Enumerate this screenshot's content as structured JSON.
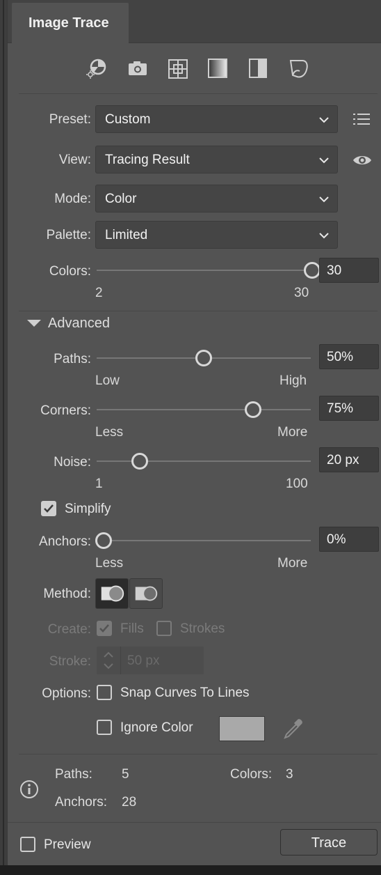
{
  "panel": {
    "tab_title": "Image Trace"
  },
  "preset_icons": [
    "auto-color-icon",
    "high-color-icon",
    "low-color-icon",
    "grayscale-icon",
    "black-and-white-icon",
    "outline-icon"
  ],
  "preset": {
    "label": "Preset:",
    "value": "Custom"
  },
  "view": {
    "label": "View:",
    "value": "Tracing Result"
  },
  "mode": {
    "label": "Mode:",
    "value": "Color"
  },
  "palette": {
    "label": "Palette:",
    "value": "Limited"
  },
  "colors": {
    "label": "Colors:",
    "value": "30",
    "min": "2",
    "max": "30",
    "level": 1.0
  },
  "advanced": {
    "label": "Advanced",
    "expanded": true
  },
  "paths": {
    "label": "Paths:",
    "value": "50%",
    "min": "Low",
    "max": "High",
    "level": 0.5
  },
  "corners": {
    "label": "Corners:",
    "value": "75%",
    "min": "Less",
    "max": "More",
    "level": 0.73
  },
  "noise": {
    "label": "Noise:",
    "value": "20 px",
    "min": "1",
    "max": "100",
    "level": 0.2
  },
  "simplify": {
    "label": "Simplify",
    "checked": true
  },
  "anchors": {
    "label": "Anchors:",
    "value": "0%",
    "min": "Less",
    "max": "More",
    "level": 0.0
  },
  "method": {
    "label": "Method:",
    "selected": "abutting"
  },
  "create": {
    "label": "Create:",
    "fills_label": "Fills",
    "fills_checked": true,
    "strokes_label": "Strokes",
    "strokes_checked": false
  },
  "stroke": {
    "label": "Stroke:",
    "value": "50 px"
  },
  "options": {
    "label": "Options:",
    "snap_label": "Snap Curves To Lines",
    "snap_checked": false,
    "ignore_label": "Ignore Color",
    "ignore_checked": false,
    "ignore_swatch": "#a9a9a9"
  },
  "info": {
    "paths_label": "Paths:",
    "paths_value": "5",
    "colors_label": "Colors:",
    "colors_value": "3",
    "anchors_label": "Anchors:",
    "anchors_value": "28"
  },
  "footer": {
    "preview_label": "Preview",
    "preview_checked": false,
    "trace_label": "Trace"
  }
}
